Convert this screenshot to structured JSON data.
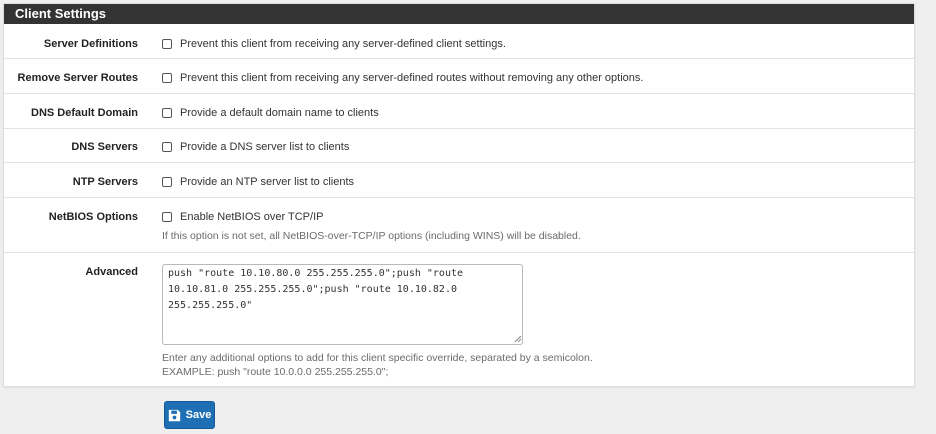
{
  "panel": {
    "title": "Client Settings"
  },
  "rows": [
    {
      "label": "Server Definitions",
      "checkbox_label": "Prevent this client from receiving any server-defined client settings.",
      "checked": false
    },
    {
      "label": "Remove Server Routes",
      "checkbox_label": "Prevent this client from receiving any server-defined routes without removing any other options.",
      "checked": false
    },
    {
      "label": "DNS Default Domain",
      "checkbox_label": "Provide a default domain name to clients",
      "checked": false
    },
    {
      "label": "DNS Servers",
      "checkbox_label": "Provide a DNS server list to clients",
      "checked": false
    },
    {
      "label": "NTP Servers",
      "checkbox_label": "Provide an NTP server list to clients",
      "checked": false
    },
    {
      "label": "NetBIOS Options",
      "checkbox_label": "Enable NetBIOS over TCP/IP",
      "checked": false,
      "help": "If this option is not set, all NetBIOS-over-TCP/IP options (including WINS) will be disabled."
    }
  ],
  "advanced": {
    "label": "Advanced",
    "value": "push \"route 10.10.80.0 255.255.255.0\";push \"route 10.10.81.0 255.255.255.0\";push \"route 10.10.82.0 255.255.255.0\"",
    "help_line1": "Enter any additional options to add for this client specific override, separated by a semicolon.",
    "help_line2": "EXAMPLE: push \"route 10.0.0.0 255.255.255.0\";"
  },
  "save_button": {
    "label": "Save",
    "icon": "save-icon"
  },
  "colors": {
    "heading_bg": "#333333",
    "button_bg": "#1f6fb5"
  }
}
